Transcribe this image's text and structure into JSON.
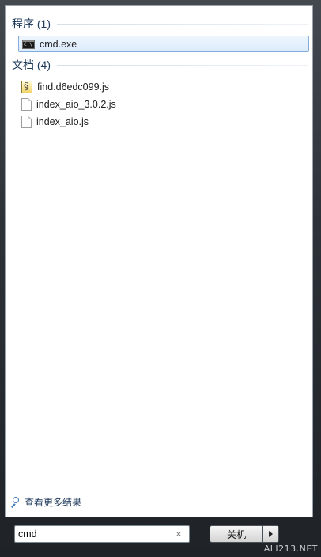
{
  "results": {
    "programs": {
      "header": "程序 (1)",
      "items": [
        {
          "label": "cmd.exe",
          "icon": "cmd-icon",
          "selected": true
        }
      ]
    },
    "documents": {
      "header": "文档 (4)",
      "items": [
        {
          "label": "find.d6edc099.js",
          "icon": "script-file-icon"
        },
        {
          "label": "index_aio_3.0.2.js",
          "icon": "file-icon"
        },
        {
          "label": "index_aio.js",
          "icon": "file-icon"
        }
      ]
    },
    "see_more": "查看更多结果"
  },
  "search": {
    "value": "cmd",
    "clear_label": "×"
  },
  "shutdown": {
    "label": "关机"
  },
  "watermark": "ALI213.NET",
  "colors": {
    "group_header": "#1e395b",
    "selection_border": "#84acdd",
    "selection_fill": "#dcebfc"
  }
}
